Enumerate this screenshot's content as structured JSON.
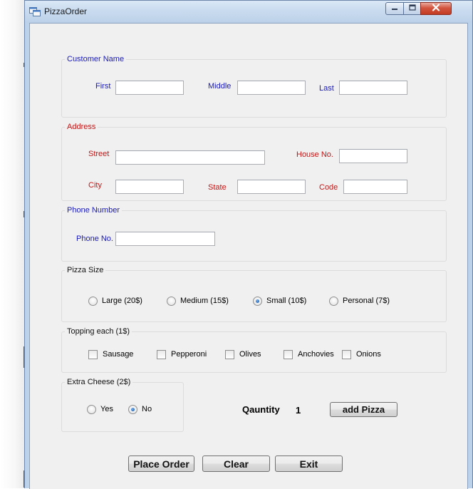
{
  "window": {
    "title": "PizzaOrder",
    "min_symbol": "–",
    "max_symbol": "▫",
    "close_symbol": "✕"
  },
  "customer_name": {
    "group_label": "Customer Name",
    "first_label": "First",
    "middle_label": "Middle",
    "last_label": "Last",
    "first_value": "",
    "middle_value": "",
    "last_value": ""
  },
  "address": {
    "group_label": "Address",
    "street_label": "Street",
    "house_label": "House No.",
    "city_label": "City",
    "state_label": "State",
    "code_label": "Code",
    "street_value": "",
    "house_value": "",
    "city_value": "",
    "state_value": "",
    "code_value": ""
  },
  "phone": {
    "group_label": "Phone Number",
    "phone_label": "Phone No.",
    "phone_value": ""
  },
  "pizza_size": {
    "group_label": "Pizza Size",
    "options": [
      {
        "label": "Large (20$)",
        "checked": false
      },
      {
        "label": "Medium (15$)",
        "checked": false
      },
      {
        "label": "Small (10$)",
        "checked": true
      },
      {
        "label": "Personal (7$)",
        "checked": false
      }
    ]
  },
  "topping": {
    "group_label": "Topping each (1$)",
    "options": [
      {
        "label": "Sausage",
        "checked": false
      },
      {
        "label": "Pepperoni",
        "checked": false
      },
      {
        "label": "Olives",
        "checked": false
      },
      {
        "label": "Anchovies",
        "checked": false
      },
      {
        "label": "Onions",
        "checked": false
      }
    ]
  },
  "extra_cheese": {
    "group_label": "Extra Cheese (2$)",
    "options": [
      {
        "label": "Yes",
        "checked": false
      },
      {
        "label": "No",
        "checked": true
      }
    ]
  },
  "quantity": {
    "label": "Qauntity",
    "value": "1",
    "add_button": "add Pizza"
  },
  "actions": {
    "place_order": "Place Order",
    "clear": "Clear",
    "exit": "Exit"
  },
  "colors": {
    "blue_label": "#1a1ab8",
    "red_label": "#c51414",
    "form_bg": "#f0f0f0",
    "frame": "#bcd2ea"
  }
}
